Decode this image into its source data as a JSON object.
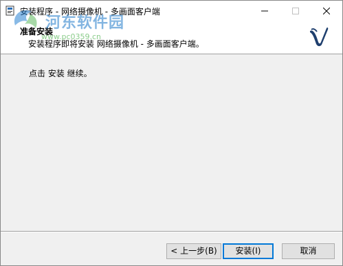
{
  "window": {
    "title": "安装程序 - 网络摄像机 - 多画面客户端"
  },
  "header": {
    "title": "准备安装",
    "subtitle": "安装程序即将安装 网络摄像机 - 多画面客户端。"
  },
  "content": {
    "instruction": "点击 安装 继续。"
  },
  "buttons": {
    "back": "< 上一步(B)",
    "install": "安装(I)",
    "cancel": "取消"
  },
  "watermark": {
    "text": "河东软件园",
    "url": "www.pc0359.cn"
  },
  "colors": {
    "accent": "#0078d7",
    "logo": "#1f3f6e"
  }
}
